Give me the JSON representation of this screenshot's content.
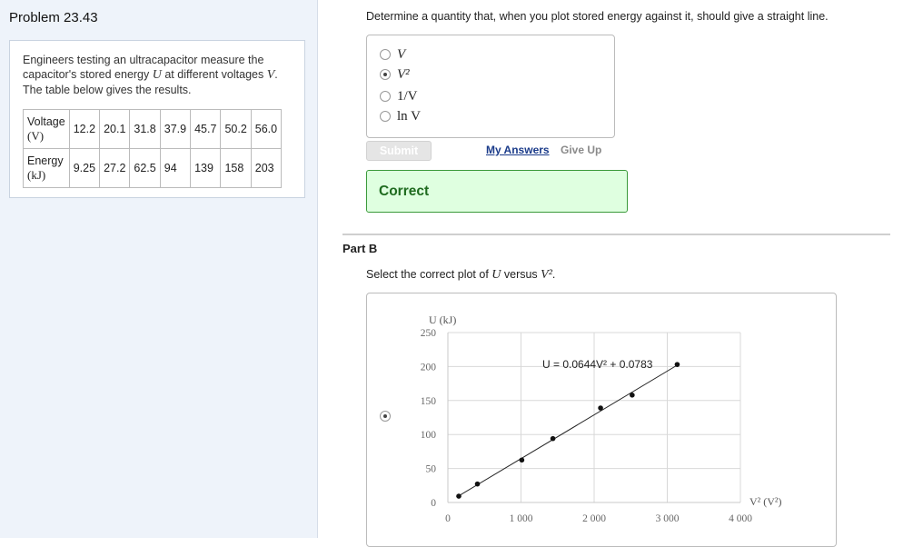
{
  "problem": {
    "title": "Problem 23.43",
    "text_parts": [
      "Engineers testing an ultracapacitor measure the capacitor's stored energy ",
      "U",
      " at different voltages ",
      "V",
      ". The table below gives the results."
    ],
    "table": {
      "row1_label": "Voltage",
      "row1_unit": "(V)",
      "row1_values": [
        "12.2",
        "20.1",
        "31.8",
        "37.9",
        "45.7",
        "50.2",
        "56.0"
      ],
      "row2_label": "Energy",
      "row2_unit": "(kJ)",
      "row2_values": [
        "9.25",
        "27.2",
        "62.5",
        "94",
        "139",
        "158",
        "203"
      ]
    }
  },
  "part_a": {
    "question": "Determine a quantity that, when you plot stored energy against it, should give a straight line.",
    "choices": [
      {
        "label": "V",
        "selected": false
      },
      {
        "label": "V²",
        "selected": true
      },
      {
        "label": "1/V",
        "selected": false
      },
      {
        "label": "ln V",
        "selected": false
      }
    ],
    "submit_label": "Submit",
    "my_answers_label": "My Answers",
    "give_up_label": "Give Up",
    "feedback": "Correct"
  },
  "part_b": {
    "heading": "Part B",
    "prompt_parts": [
      "Select the correct plot of ",
      "U",
      " versus ",
      "V²",
      "."
    ],
    "option_selected": true
  },
  "chart_data": {
    "type": "scatter",
    "ylabel": "U (kJ)",
    "xlabel": "V² (V²)",
    "xlim": [
      0,
      4000
    ],
    "ylim": [
      0,
      250
    ],
    "xticks": [
      "0",
      "1 000",
      "2 000",
      "3 000",
      "4 000"
    ],
    "yticks": [
      "0",
      "50",
      "100",
      "150",
      "200",
      "250"
    ],
    "x": [
      149,
      404,
      1011,
      1436,
      2088,
      2520,
      3136
    ],
    "y": [
      9.25,
      27.2,
      62.5,
      94,
      139,
      158,
      203
    ],
    "fit_equation": "U = 0.0644V² + 0.0783",
    "fit": {
      "slope": 0.0644,
      "intercept": 0.0783
    },
    "grid": true
  },
  "colors": {
    "left_panel": "#eef3fa",
    "correct_bg": "#dfffe0",
    "correct_border": "#3a9a3a",
    "link": "#1a3b8a"
  }
}
